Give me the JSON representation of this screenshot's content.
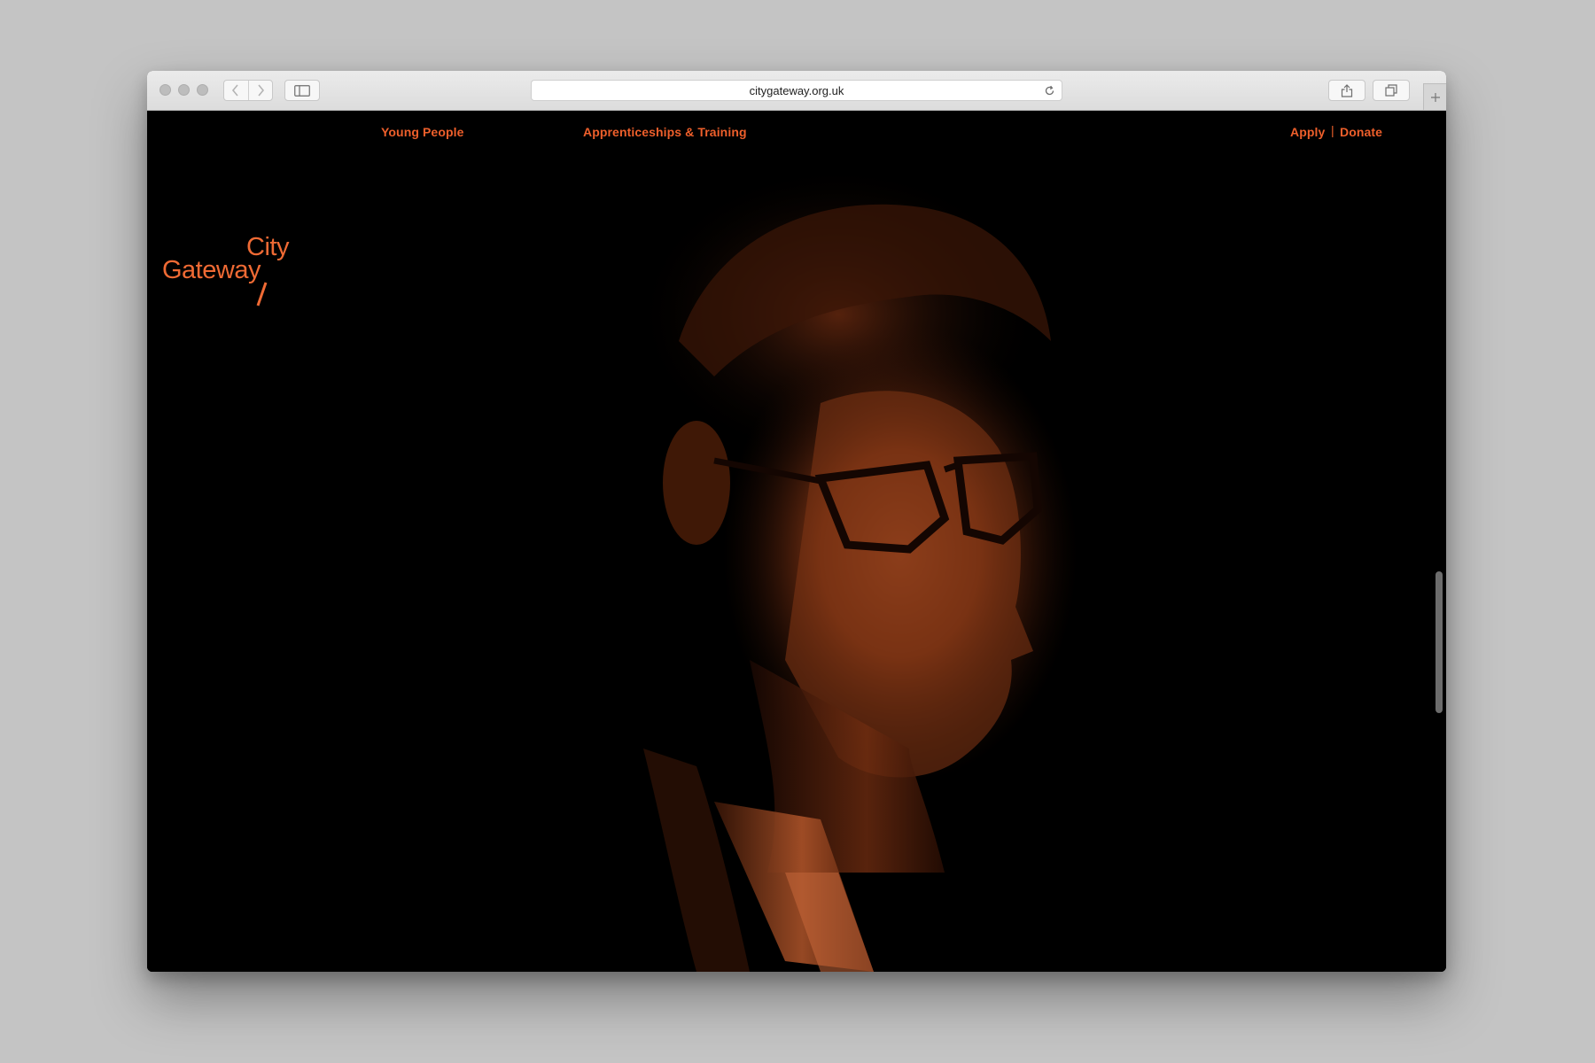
{
  "browser": {
    "url": "citygateway.org.uk"
  },
  "site": {
    "logo": {
      "line1": "City",
      "line2": "Gateway"
    },
    "nav": {
      "young_people": "Young People",
      "apprenticeships": "Apprenticeships & Training",
      "apply": "Apply",
      "divider": "|",
      "donate": "Donate"
    }
  },
  "colors": {
    "accent": "#ee5f2b",
    "background": "#000000"
  },
  "icons": {
    "back": "chevron-left-icon",
    "forward": "chevron-right-icon",
    "sidebar": "sidebar-icon",
    "reload": "reload-icon",
    "share": "share-icon",
    "tabs": "tabs-icon",
    "new_tab": "plus-icon"
  }
}
